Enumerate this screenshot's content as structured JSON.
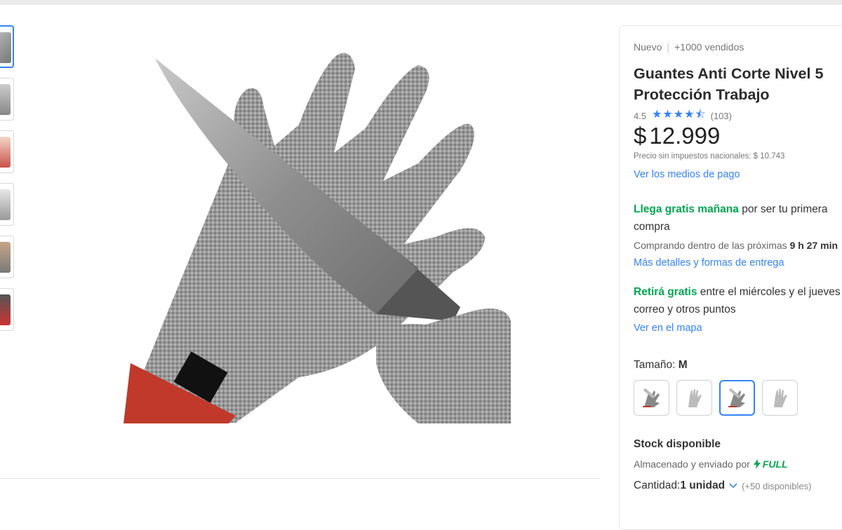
{
  "product": {
    "condition": "Nuevo",
    "sold": "+1000 vendidos",
    "title_line1": "Guantes Anti Corte Nivel 5",
    "title_line2": "Protección Trabajo",
    "rating": "4.5",
    "stars": "★★★★⯪",
    "review_count": "(103)",
    "currency": "$",
    "price": "12.999",
    "tax_note": "Precio sin impuestos nacionales: $ 10.743",
    "payment_link": "Ver los medios de pago"
  },
  "shipping": {
    "free_tomorrow": "Llega gratis mañana",
    "free_tomorrow_rest": " por ser tu primera",
    "line2": "compra",
    "buy_within_prefix": "Comprando dentro de las próximas ",
    "buy_within_time": "9 h 27 min",
    "details_link": "Más detalles y formas de entrega",
    "pickup_free": "Retirá gratis",
    "pickup_rest": " entre el miércoles y el jueves en",
    "pickup_line2": "correo y otros puntos",
    "map_link": "Ver en el mapa"
  },
  "variant": {
    "label": "Tamaño: ",
    "selected": "M"
  },
  "stock": {
    "title": "Stock disponible",
    "stored_prefix": "Almacenado y enviado por ",
    "full_badge": "FULL",
    "qty_label": "Cantidad: ",
    "qty_value": "1 unidad",
    "qty_available": "(+50 disponibles)"
  },
  "icons": {
    "full": "bolt-icon",
    "qty": "chevron-down-icon",
    "stars": "star-icon"
  },
  "colors": {
    "accent": "#3483fa",
    "green": "#00a650"
  }
}
